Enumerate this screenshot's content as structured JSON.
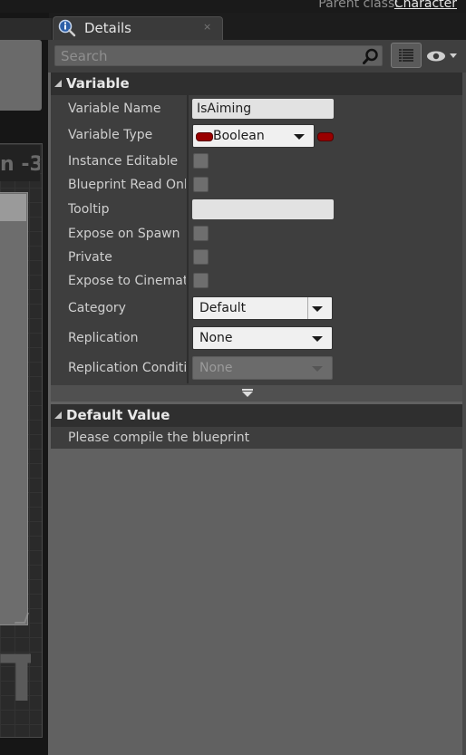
{
  "header": {
    "parent_class_label": "Parent class:",
    "parent_class_value": "Character"
  },
  "left_graph": {
    "title_fragment": "n -3",
    "big_letter": "T"
  },
  "details_tab": {
    "title": "Details",
    "close_glyph": "×",
    "icon": "info-magnifier-icon"
  },
  "toolbar": {
    "search_placeholder": "Search",
    "search_icon": "search-icon",
    "grid_icon": "property-matrix-icon",
    "eye_icon": "visibility-eye-icon"
  },
  "variable_section": {
    "title": "Variable",
    "rows": {
      "variable_name": {
        "label": "Variable Name",
        "value": "IsAiming"
      },
      "variable_type": {
        "label": "Variable Type",
        "value": "Boolean",
        "pin_color": "#9a0000"
      },
      "instance_editable": {
        "label": "Instance Editable",
        "checked": false
      },
      "blueprint_read_only": {
        "label": "Blueprint Read Only",
        "checked": false
      },
      "tooltip": {
        "label": "Tooltip",
        "value": ""
      },
      "expose_on_spawn": {
        "label": "Expose on Spawn",
        "checked": false
      },
      "private": {
        "label": "Private",
        "checked": false
      },
      "expose_to_cinematics": {
        "label": "Expose to Cinematics",
        "checked": false
      },
      "category": {
        "label": "Category",
        "value": "Default"
      },
      "replication": {
        "label": "Replication",
        "value": "None"
      },
      "replication_condition": {
        "label": "Replication Condition",
        "value": "None"
      }
    }
  },
  "default_value_section": {
    "title": "Default Value",
    "message": "Please compile the blueprint"
  }
}
